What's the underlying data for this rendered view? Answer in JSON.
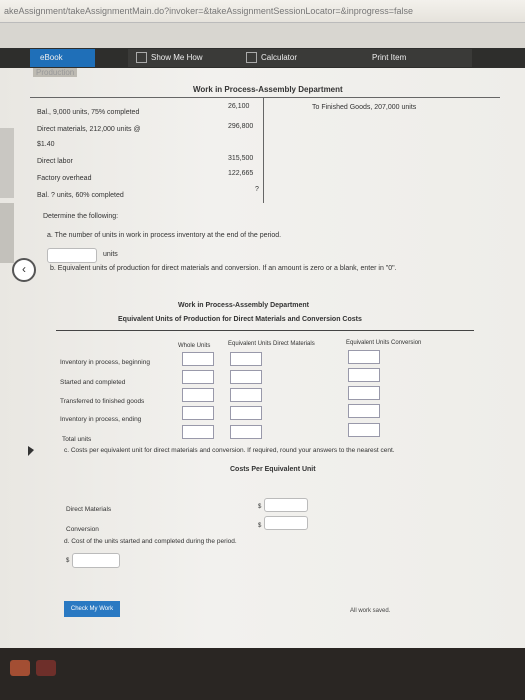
{
  "browser": {
    "url": "akeAssignment/takeAssignmentMain.do?invoker=&takeAssignmentSessionLocator=&inprogress=false"
  },
  "toolbar": {
    "ebook_label": "eBook",
    "show_me_how_label": "Show Me How",
    "calculator_label": "Calculator",
    "print_item_label": "Print Item"
  },
  "cut_header": "Production",
  "account": {
    "title": "Work in Process-Assembly Department",
    "debit_lines": [
      {
        "label": "Bal., 9,000 units, 75% completed",
        "amount": "26,100"
      },
      {
        "label": "Direct materials, 212,000 units @",
        "amount": "296,800"
      },
      {
        "label": "$1.40",
        "amount": ""
      },
      {
        "label": "Direct labor",
        "amount": "315,500"
      },
      {
        "label": "Factory overhead",
        "amount": "122,665"
      },
      {
        "label": "Bal. ? units, 60% completed",
        "amount": "?"
      }
    ],
    "credit_line": "To Finished Goods, 207,000 units"
  },
  "instruction": "Determine the following:",
  "part_a": {
    "question": "a.  The number of units in work in process inventory at the end of the period.",
    "input_value": "",
    "unit_label": "units"
  },
  "part_b": {
    "question": "b.  Equivalent units of production for direct materials and conversion. If an amount is zero or a blank, enter in \"0\".",
    "title1": "Work in Process-Assembly Department",
    "title2": "Equivalent Units of Production for Direct Materials and Conversion Costs",
    "columns": [
      "Whole Units",
      "Equivalent Units Direct Materials",
      "Equivalent Units Conversion"
    ],
    "rows": [
      "Inventory in process, beginning",
      "Started and completed",
      "Transferred to finished goods",
      "Inventory in process, ending",
      "Total units"
    ]
  },
  "part_c": {
    "question": "c.  Costs per equivalent unit for direct materials and conversion. If required, round your answers to the nearest cent.",
    "title": "Costs Per Equivalent Unit",
    "rows": [
      {
        "label": "Direct Materials",
        "currency": "$",
        "value": ""
      },
      {
        "label": "Conversion",
        "currency": "$",
        "value": ""
      }
    ]
  },
  "part_d": {
    "question": "d.  Cost of the units started and completed during the period.",
    "currency": "$",
    "value": ""
  },
  "check_button_label": "Check My Work",
  "saved_status": "All work saved."
}
